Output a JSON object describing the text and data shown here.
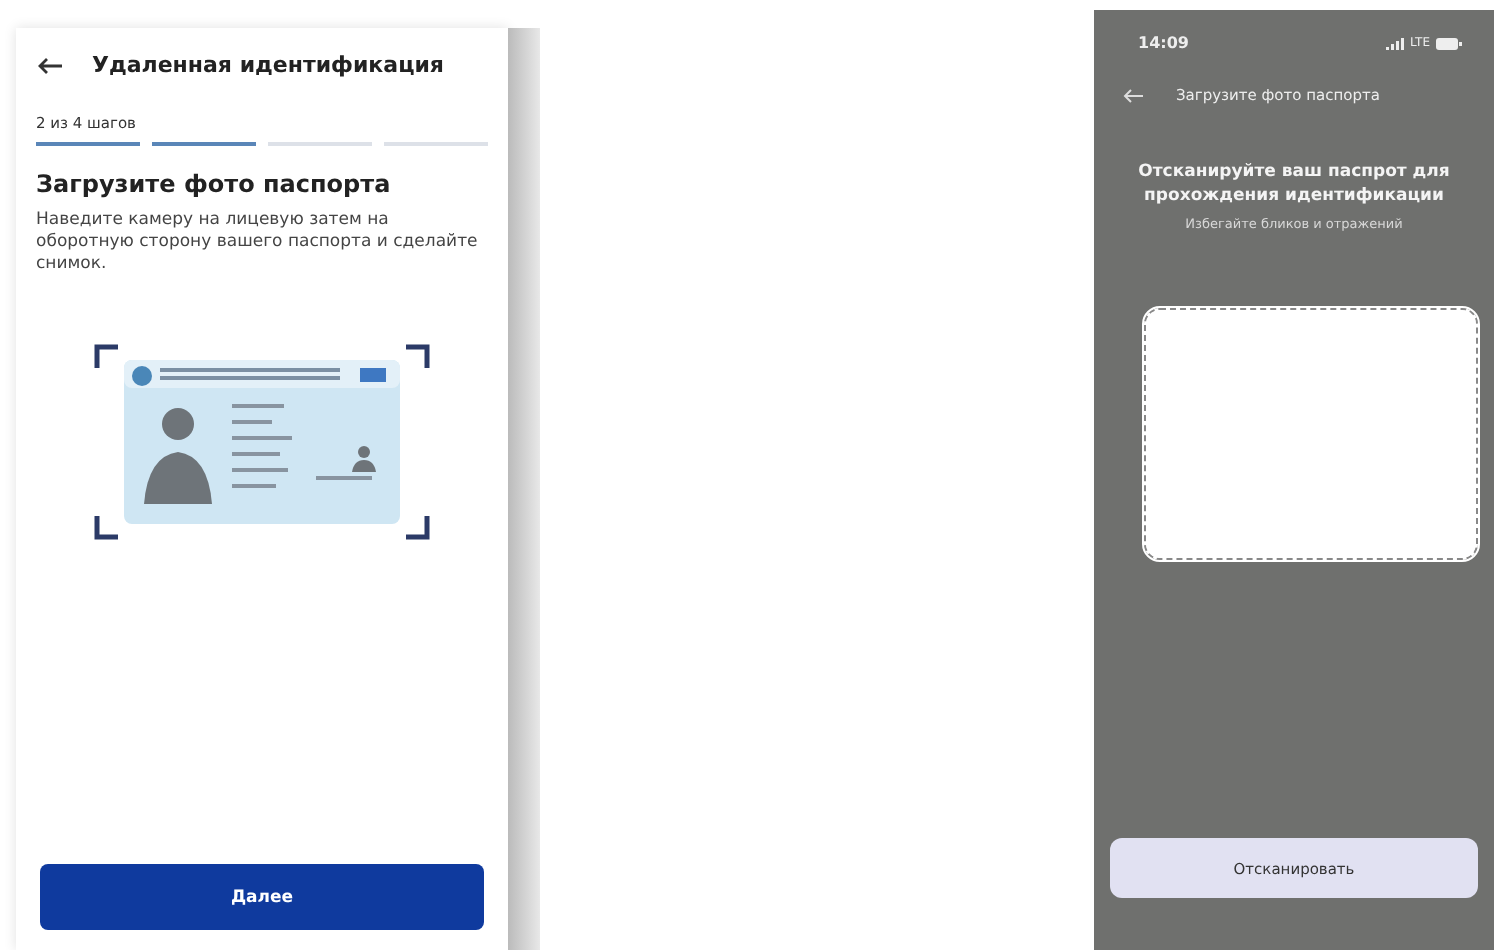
{
  "left_screen": {
    "header": {
      "title": "Удаленная идентификация"
    },
    "progress": {
      "label": "2 из 4 шагов",
      "steps": [
        {
          "done": true
        },
        {
          "done": true
        },
        {
          "done": false
        },
        {
          "done": false
        }
      ]
    },
    "heading": "Загрузите фото паспорта",
    "description": "Наведите камеру на лицевую затем на оборотную сторону вашего паспорта и сделайте снимок.",
    "button": "Далее"
  },
  "right_screen": {
    "status_bar": {
      "time": "14:09",
      "network": "LTE"
    },
    "header": {
      "title": "Загрузите фото паспорта"
    },
    "heading": "Отсканируйте ваш паспрот для прохождения идентификации",
    "hint": "Избегайте бликов и отражений",
    "button": "Отсканировать"
  }
}
